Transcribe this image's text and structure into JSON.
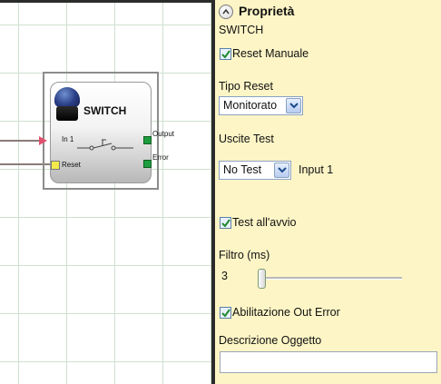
{
  "block": {
    "title": "SWITCH",
    "inputs": {
      "in1": "In 1",
      "reset": "Reset"
    },
    "outputs": {
      "output": "Output",
      "error": "Error"
    }
  },
  "panel": {
    "title": "Proprietà",
    "block_type": "SWITCH",
    "reset_manuale": {
      "label": "Reset Manuale",
      "checked": true
    },
    "tipo_reset": {
      "label": "Tipo Reset",
      "value": "Monitorato"
    },
    "uscite_test": {
      "label": "Uscite Test",
      "value": "No Test",
      "input_label": "Input 1"
    },
    "test_avvio": {
      "label": "Test all'avvio",
      "checked": true
    },
    "filtro": {
      "label": "Filtro (ms)",
      "value": "3",
      "slider_level": 0
    },
    "abilitazione_out_error": {
      "label": "Abilitazione Out Error",
      "checked": true
    },
    "descrizione": {
      "label": "Descrizione Oggetto",
      "value": ""
    }
  },
  "colors": {
    "panel_bg": "#fdf5c6",
    "pin_in": "#e0506e",
    "pin_reset": "#f3e94a",
    "pin_out": "#1e9d3e",
    "button_cap": "#2a3f86"
  },
  "icons": [
    "collapse-up-icon",
    "checkmark-icon",
    "dropdown-arrow-icon",
    "push-button-icon",
    "switch-contact-icon"
  ]
}
